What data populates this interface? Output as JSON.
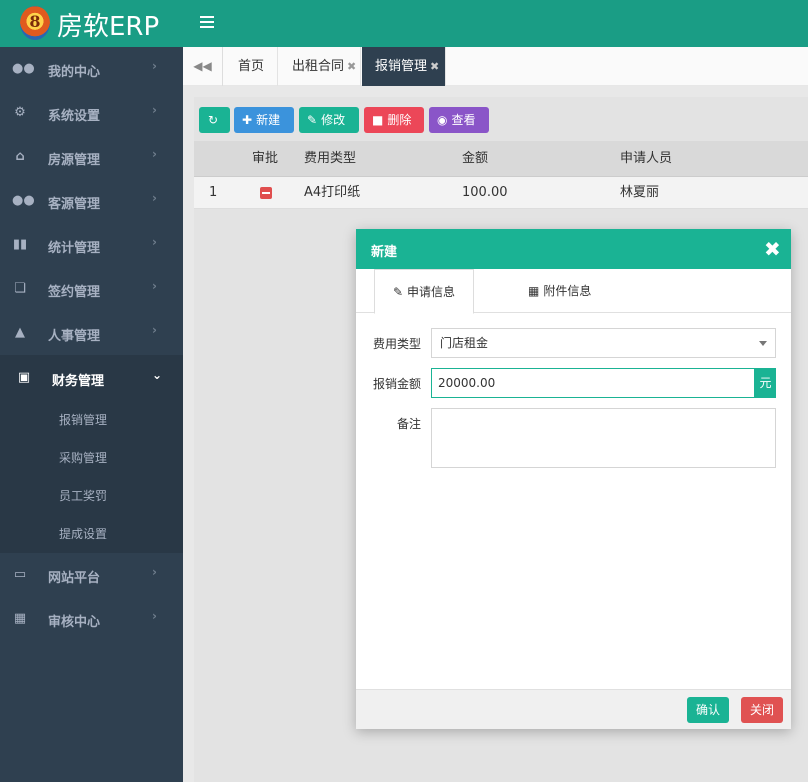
{
  "app": {
    "logo_glyph": "8",
    "brand": "房软ERP"
  },
  "sidebar": {
    "items": [
      {
        "label": "我的中心",
        "icon": "users-icon"
      },
      {
        "label": "系统设置",
        "icon": "cogs-icon"
      },
      {
        "label": "房源管理",
        "icon": "home-icon"
      },
      {
        "label": "客源管理",
        "icon": "group-icon"
      },
      {
        "label": "统计管理",
        "icon": "bar-chart-icon"
      },
      {
        "label": "签约管理",
        "icon": "copy-icon"
      },
      {
        "label": "人事管理",
        "icon": "sitemap-icon"
      },
      {
        "label": "财务管理",
        "icon": "credit-card-icon"
      },
      {
        "label": "网站平台",
        "icon": "desktop-icon"
      },
      {
        "label": "审核中心",
        "icon": "gift-icon"
      }
    ],
    "finance_submenu": [
      "报销管理",
      "采购管理",
      "员工奖罚",
      "提成设置"
    ]
  },
  "tabs": [
    {
      "label": "首页"
    },
    {
      "label": "出租合同"
    },
    {
      "label": "报销管理"
    }
  ],
  "toolbar": {
    "new_label": "新建",
    "edit_label": "修改",
    "delete_label": "删除",
    "view_label": "查看"
  },
  "table": {
    "headers": [
      "审批",
      "费用类型",
      "金额",
      "申请人员"
    ],
    "rows": [
      {
        "index": "1",
        "fee_type": "A4打印纸",
        "amount": "100.00",
        "applicant": "林夏丽"
      }
    ]
  },
  "modal": {
    "title": "新建",
    "tab_apply": "申请信息",
    "tab_attach": "附件信息",
    "fee_type_label": "费用类型",
    "fee_type_value": "门店租金",
    "amount_label": "报销金额",
    "amount_value": "20000.00",
    "amount_unit": "元",
    "note_label": "备注",
    "note_value": "",
    "confirm_label": "确认",
    "close_label": "关闭"
  },
  "colors": {
    "accent": "#1ab394",
    "sidebar_bg": "#2f4050",
    "danger": "#ec4758",
    "primary": "#3b93dc",
    "purple": "#8a55c8"
  }
}
